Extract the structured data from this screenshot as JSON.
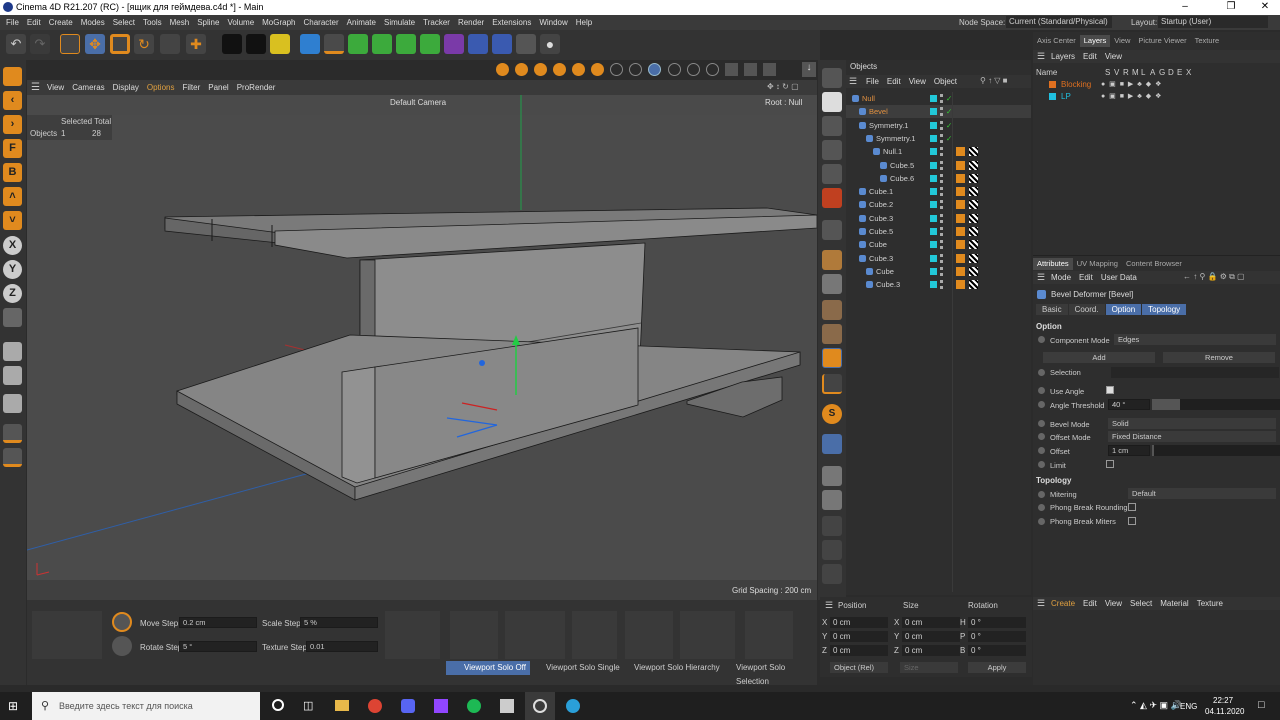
{
  "window": {
    "title": "Cinema 4D R21.207 (RC) - [ящик для геймдева.c4d *] - Main"
  },
  "menu": [
    "File",
    "Edit",
    "Create",
    "Modes",
    "Select",
    "Tools",
    "Mesh",
    "Spline",
    "Volume",
    "MoGraph",
    "Character",
    "Animate",
    "Simulate",
    "Tracker",
    "Render",
    "Extensions",
    "Window",
    "Help"
  ],
  "node_space": {
    "label": "Node Space:",
    "value": "Current (Standard/Physical)"
  },
  "layout": {
    "label": "Layout:",
    "value": "Startup (User)"
  },
  "viewport": {
    "menu": [
      "View",
      "Cameras",
      "Display",
      "Options",
      "Filter",
      "Panel",
      "ProRender"
    ],
    "camera": "Default Camera",
    "root": "Root : Null",
    "stats_header": "Selected Total",
    "stats_label": "Objects",
    "stats_selected": "1",
    "stats_total": "28",
    "grid_spacing": "Grid Spacing : 200 cm"
  },
  "left_tools": [
    "B",
    "F",
    "B",
    "X",
    "Y",
    "Z"
  ],
  "objects_panel": {
    "title": "Objects",
    "menu": [
      "File",
      "Edit",
      "View",
      "Object"
    ],
    "rows": [
      {
        "name": "Null",
        "indent": 0,
        "color": "#e09040"
      },
      {
        "name": "Bevel",
        "indent": 1,
        "color": "#e09040"
      },
      {
        "name": "Symmetry.1",
        "indent": 1,
        "color": "#cfcfcf"
      },
      {
        "name": "Symmetry.1",
        "indent": 2,
        "color": "#cfcfcf"
      },
      {
        "name": "Null.1",
        "indent": 3,
        "color": "#cfcfcf"
      },
      {
        "name": "Cube.5",
        "indent": 4,
        "color": "#cfcfcf"
      },
      {
        "name": "Cube.6",
        "indent": 4,
        "color": "#cfcfcf"
      },
      {
        "name": "Cube.1",
        "indent": 1,
        "color": "#cfcfcf"
      },
      {
        "name": "Cube.2",
        "indent": 1,
        "color": "#cfcfcf"
      },
      {
        "name": "Cube.3",
        "indent": 1,
        "color": "#cfcfcf"
      },
      {
        "name": "Cube.5",
        "indent": 1,
        "color": "#cfcfcf"
      },
      {
        "name": "Cube",
        "indent": 1,
        "color": "#cfcfcf"
      },
      {
        "name": "Cube.3",
        "indent": 1,
        "color": "#cfcfcf"
      },
      {
        "name": "Cube",
        "indent": 2,
        "color": "#cfcfcf"
      },
      {
        "name": "Cube.3",
        "indent": 2,
        "color": "#cfcfcf"
      }
    ]
  },
  "layers_panel": {
    "tabs": [
      "Axis Center",
      "Layers",
      "View",
      "Picture Viewer",
      "Texture"
    ],
    "menu": [
      "Layers",
      "Edit",
      "View"
    ],
    "columns": [
      "Name",
      "S",
      "V",
      "R",
      "M",
      "L",
      "A",
      "G",
      "D",
      "E",
      "X"
    ],
    "rows": [
      {
        "name": "Blocking",
        "color": "#e07020"
      },
      {
        "name": "LP",
        "color": "#20c0e0"
      }
    ]
  },
  "attributes": {
    "tabs": [
      "Attributes",
      "UV Mapping",
      "Content Browser"
    ],
    "menu": [
      "Mode",
      "Edit",
      "User Data"
    ],
    "object_title": "Bevel Deformer [Bevel]",
    "subtabs": [
      "Basic",
      "Coord.",
      "Option",
      "Topology"
    ],
    "section_option": "Option",
    "component_mode_label": "Component Mode",
    "component_mode_value": "Edges",
    "add_label": "Add",
    "remove_label": "Remove",
    "selection_label": "Selection",
    "use_angle_label": "Use Angle",
    "angle_threshold_label": "Angle Threshold",
    "angle_threshold_value": "40 °",
    "bevel_mode_label": "Bevel Mode",
    "bevel_mode_value": "Solid",
    "offset_mode_label": "Offset Mode",
    "offset_mode_value": "Fixed Distance",
    "offset_label": "Offset",
    "offset_value": "1 cm",
    "limit_label": "Limit",
    "section_topology": "Topology",
    "mitering_label": "Mitering",
    "mitering_value": "Default",
    "phong_rounding_label": "Phong Break Rounding",
    "phong_miters_label": "Phong Break Miters"
  },
  "materials": {
    "menu": [
      "Create",
      "Edit",
      "View",
      "Select",
      "Material",
      "Texture"
    ]
  },
  "bottom": {
    "move_step_label": "Move Step",
    "move_step_value": "0.2 cm",
    "scale_step_label": "Scale Step",
    "scale_step_value": "5 %",
    "rotate_step_label": "Rotate Step",
    "rotate_step_value": "5 °",
    "texture_step_label": "Texture Step",
    "texture_step_value": "0.01",
    "solo": [
      "Viewport Solo Off",
      "Viewport Solo Single",
      "Viewport Solo Hierarchy",
      "Viewport Solo Selection"
    ]
  },
  "coords": {
    "headers": [
      "Position",
      "Size",
      "Rotation"
    ],
    "rows": [
      {
        "axis": "X",
        "pos": "0 cm",
        "size_axis": "X",
        "size": "0 cm",
        "rot_axis": "H",
        "rot": "0 °"
      },
      {
        "axis": "Y",
        "pos": "0 cm",
        "size_axis": "Y",
        "size": "0 cm",
        "rot_axis": "P",
        "rot": "0 °"
      },
      {
        "axis": "Z",
        "pos": "0 cm",
        "size_axis": "Z",
        "size": "0 cm",
        "rot_axis": "B",
        "rot": "0 °"
      }
    ],
    "mode": "Object (Rel)",
    "size_mode": "Size",
    "apply": "Apply"
  },
  "taskbar": {
    "search_placeholder": "Введите здесь текст для поиска",
    "lang": "ENG",
    "time": "22:27",
    "date": "04.11.2020"
  },
  "colors": {
    "accent_orange": "#e08a1e",
    "selection_blue": "#4a6ea8",
    "cyan": "#22c8d8"
  }
}
